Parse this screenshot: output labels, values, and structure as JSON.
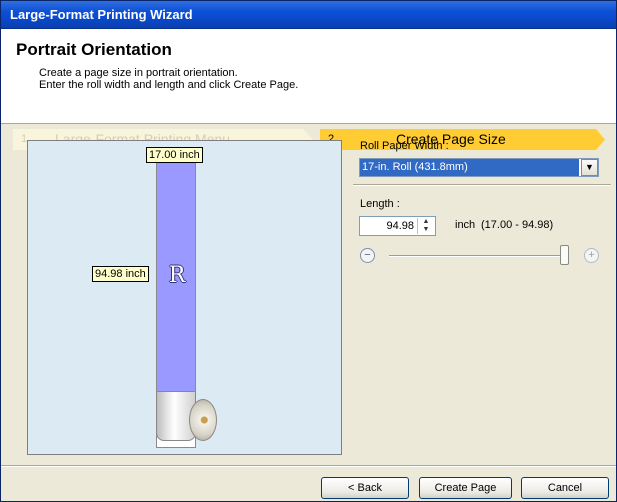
{
  "window": {
    "title": "Large-Format Printing Wizard"
  },
  "header": {
    "title": "Portrait Orientation",
    "description_line1": "Create a page size in portrait orientation.",
    "description_line2": "Enter the roll width and length and click Create Page."
  },
  "steps": [
    {
      "number": "1",
      "label": "Large-Format Printing Menu",
      "active": false
    },
    {
      "number": "2",
      "label": "Create Page Size",
      "active": true
    }
  ],
  "preview": {
    "width_tag": "17.00 inch",
    "length_tag": "94.98 inch",
    "mark": "R"
  },
  "roll_paper": {
    "label": "Roll Paper Width :",
    "selected": "17-in. Roll (431.8mm)"
  },
  "length": {
    "label": "Length :",
    "value": "94.98",
    "unit": "inch",
    "range": "(17.00 - 94.98)",
    "slider_fraction": 1.0
  },
  "buttons": {
    "back": "< Back",
    "create": "Create Page",
    "cancel": "Cancel"
  },
  "colors": {
    "active_step": "#ffcc33",
    "paper": "#9999ff",
    "preview_bg": "#dceaf4",
    "selection": "#316ac5"
  }
}
